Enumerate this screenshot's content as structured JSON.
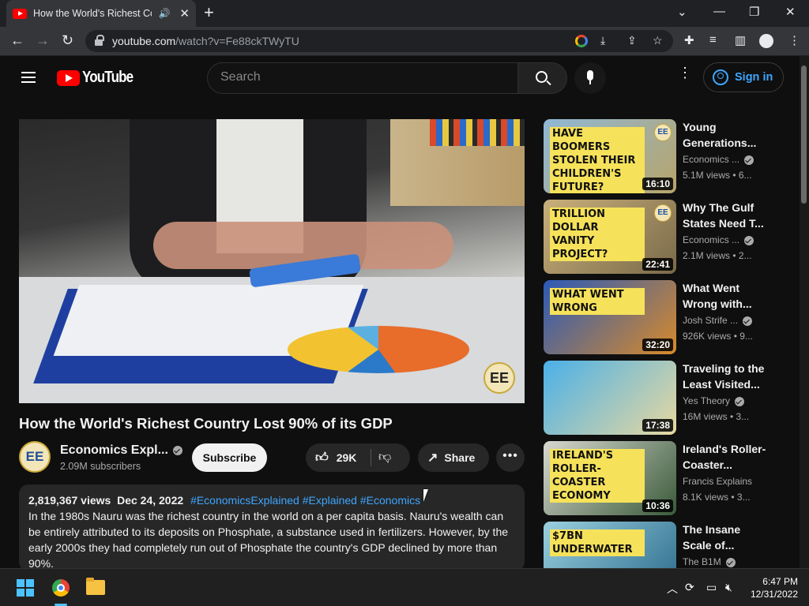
{
  "browser": {
    "tab_title": "How the World's Richest Cou",
    "tab_audio": "🔊",
    "tab_close": "✕",
    "new_tab": "+",
    "url_host": "youtube.com",
    "url_path": "/watch?v=Fe88ckTWyTU",
    "back": "←",
    "forward": "→",
    "reload": "↻",
    "minimize": "—",
    "restore": "❐",
    "close": "✕",
    "tabs_menu": "⌄"
  },
  "youtube": {
    "logo_text": "YouTube",
    "search_placeholder": "Search",
    "sign_in": "Sign in",
    "more": "⋮"
  },
  "video": {
    "title": "How the World's Richest Country Lost 90% of its GDP",
    "channel": "Economics Expl...",
    "channel_initials": "EE",
    "subscribers": "2.09M subscribers",
    "subscribe_label": "Subscribe",
    "likes": "29K",
    "share_label": "Share",
    "more_label": "•••",
    "watermark": "EE",
    "views": "2,819,367 views",
    "date": "Dec 24, 2022",
    "hashtags": "#EconomicsExplained #Explained #Economics",
    "description": "In the 1980s Nauru was the richest country in the world on a per capita basis. Nauru's wealth can be entirely attributed to its deposits on Phosphate, a substance used in fertilizers. However, by the early 2000s they had completely run out of Phosphate the country's GDP declined by more than 90%."
  },
  "recommendations": [
    {
      "title": "Young Generations...",
      "channel": "Economics ...",
      "verified": true,
      "meta": "5.1M views  •  6...",
      "duration": "16:10",
      "thumb_text": "Have Boomers Stolen Their Children's Future?",
      "thumb_colors": [
        "#8fb8d6",
        "#b7a46a"
      ]
    },
    {
      "title": "Why The Gulf States Need T...",
      "channel": "Economics ...",
      "verified": true,
      "meta": "2.1M views  •  2...",
      "duration": "22:41",
      "thumb_text": "Trillion Dollar Vanity Project?",
      "thumb_colors": [
        "#c9b07a",
        "#7a6a4a"
      ]
    },
    {
      "title": "What Went Wrong with...",
      "channel": "Josh Strife ...",
      "verified": true,
      "meta": "926K views  •  9...",
      "duration": "32:20",
      "thumb_text": "What Went Wrong",
      "thumb_colors": [
        "#2a5ab8",
        "#d88a2a"
      ]
    },
    {
      "title": "Traveling to the Least Visited...",
      "channel": "Yes Theory",
      "verified": true,
      "meta": "16M views  •  3...",
      "duration": "17:38",
      "thumb_text": "",
      "thumb_colors": [
        "#4ab0e8",
        "#e8d8a0"
      ]
    },
    {
      "title": "Ireland's Roller-Coaster...",
      "channel": "Francis Explains",
      "verified": false,
      "meta": "8.1K views  •  3...",
      "duration": "10:36",
      "thumb_text": "Ireland's roller-coaster economy",
      "thumb_colors": [
        "#d8d8d0",
        "#3a5a3a"
      ]
    },
    {
      "title": "The Insane Scale of...",
      "channel": "The B1M",
      "verified": true,
      "meta": "",
      "duration": "",
      "thumb_text": "$7BN UNDERWATER",
      "thumb_colors": [
        "#9ad0e0",
        "#2a6a8a"
      ]
    }
  ],
  "taskbar": {
    "time": "6:47 PM",
    "date": "12/31/2022"
  }
}
